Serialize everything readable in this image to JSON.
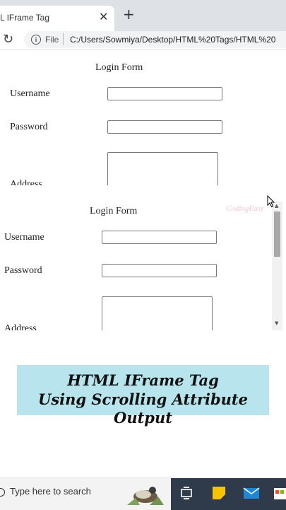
{
  "browser": {
    "tab_title": "L IFrame Tag",
    "tab_close": "✕",
    "new_tab": "+",
    "reload": "↻",
    "info": "i",
    "scheme_label": "File",
    "url": "C:/Users/Sowmiya/Desktop/HTML%20Tags/HTML%20"
  },
  "outer_form": {
    "title": "Login Form",
    "username_label": "Username",
    "password_label": "Password",
    "address_label": "Address"
  },
  "iframe_form": {
    "title": "Login Form",
    "username_label": "Username",
    "password_label": "Password",
    "address_label": "Address",
    "watermark": "CodingEasy"
  },
  "caption": {
    "line1": "HTML  IFrame Tag",
    "line2": "Using Scrolling Attribute Output"
  },
  "taskbar": {
    "search_placeholder": "Type here to search"
  },
  "colors": {
    "banner": "#b8e4ed",
    "taskbar_dark": "#2f3a4a"
  }
}
